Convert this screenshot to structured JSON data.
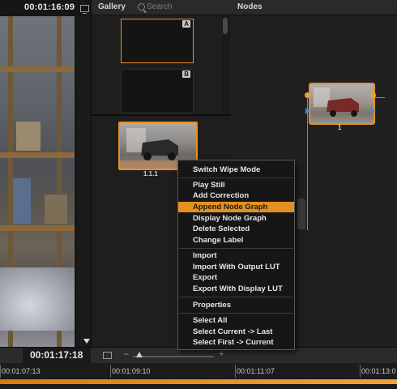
{
  "viewer": {
    "timecode": "00:01:16:09",
    "monitor_icon": "monitor-icon"
  },
  "gallery": {
    "title": "Gallery",
    "search_placeholder": "Search",
    "stills": [
      {
        "label": "A",
        "selected": true
      },
      {
        "label": "B",
        "selected": false
      }
    ],
    "memory_still_label": "1.1.1"
  },
  "nodes": {
    "title": "Nodes",
    "node_label": "1"
  },
  "bottom_bar": {
    "timecode": "00:01:17:18"
  },
  "timeline": {
    "ticks": [
      "00:01:07:13",
      "00:01:09:10",
      "00:01:11:07",
      "00:01:13:0"
    ]
  },
  "context_menu": {
    "groups": [
      [
        "Switch Wipe Mode"
      ],
      [
        "Play Still",
        "Add Correction",
        "Append Node Graph",
        "Display Node Graph",
        "Delete Selected",
        "Change Label"
      ],
      [
        "Import",
        "Import With Output LUT",
        "Export",
        "Export With Display LUT"
      ],
      [
        "Properties"
      ],
      [
        "Select All",
        "Select Current -> Last",
        "Select First -> Current"
      ]
    ],
    "highlighted": "Append Node Graph"
  },
  "colors": {
    "accent": "#e8901f",
    "menu_highlight": "#e29021",
    "rgb_connector": "#3a8fd8"
  }
}
